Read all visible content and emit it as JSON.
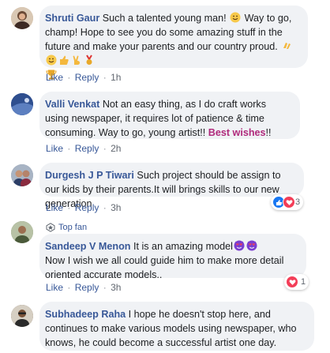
{
  "comments": [
    {
      "author": "Shruti Gaur",
      "text1": "Such a talented young man! ",
      "text2": " Way to go, champ! Hope to see you do some amazing stuff in the future and make your parents and our country proud. ",
      "like": "Like",
      "reply": "Reply",
      "time": "1h"
    },
    {
      "author": "Valli Venkat",
      "text1": "Not an easy thing, as I do craft works using newspaper, it requires lot of patience & time consuming. Way to go, young artist!! ",
      "highlight": "Best wishes",
      "text2": "!!",
      "like": "Like",
      "reply": "Reply",
      "time": "2h"
    },
    {
      "author": "Durgesh J P Tiwari",
      "text1": "Such project should be assign to our kids by their parents.It will brings skills to our new generation",
      "like": "Like",
      "reply": "Reply",
      "time": "3h",
      "reaction_count": "3"
    },
    {
      "badge": "Top fan",
      "author": "Sandeep V Menon",
      "text1": "It is an amazing model",
      "text2": "Now I wish we all could guide him to make more detail oriented accurate models..",
      "like": "Like",
      "reply": "Reply",
      "time": "3h",
      "reaction_count": "1"
    },
    {
      "author": "Subhadeep Raha",
      "text1": "I hope he doesn't stop here, and continues to make various models using newspaper, who knows, he could become a successful artist one day."
    }
  ],
  "colors": {
    "author": "#385898",
    "bubble": "#f0f2f5",
    "highlight": "#b02a7c",
    "meta": "#616770"
  },
  "icons": [
    "smile-emoji",
    "clap-emoji",
    "thumbs-up-emoji",
    "victory-emoji",
    "medal-emoji",
    "trophy-emoji",
    "heart-eyes-emoji",
    "like-reaction",
    "love-reaction",
    "top-fan-icon"
  ]
}
